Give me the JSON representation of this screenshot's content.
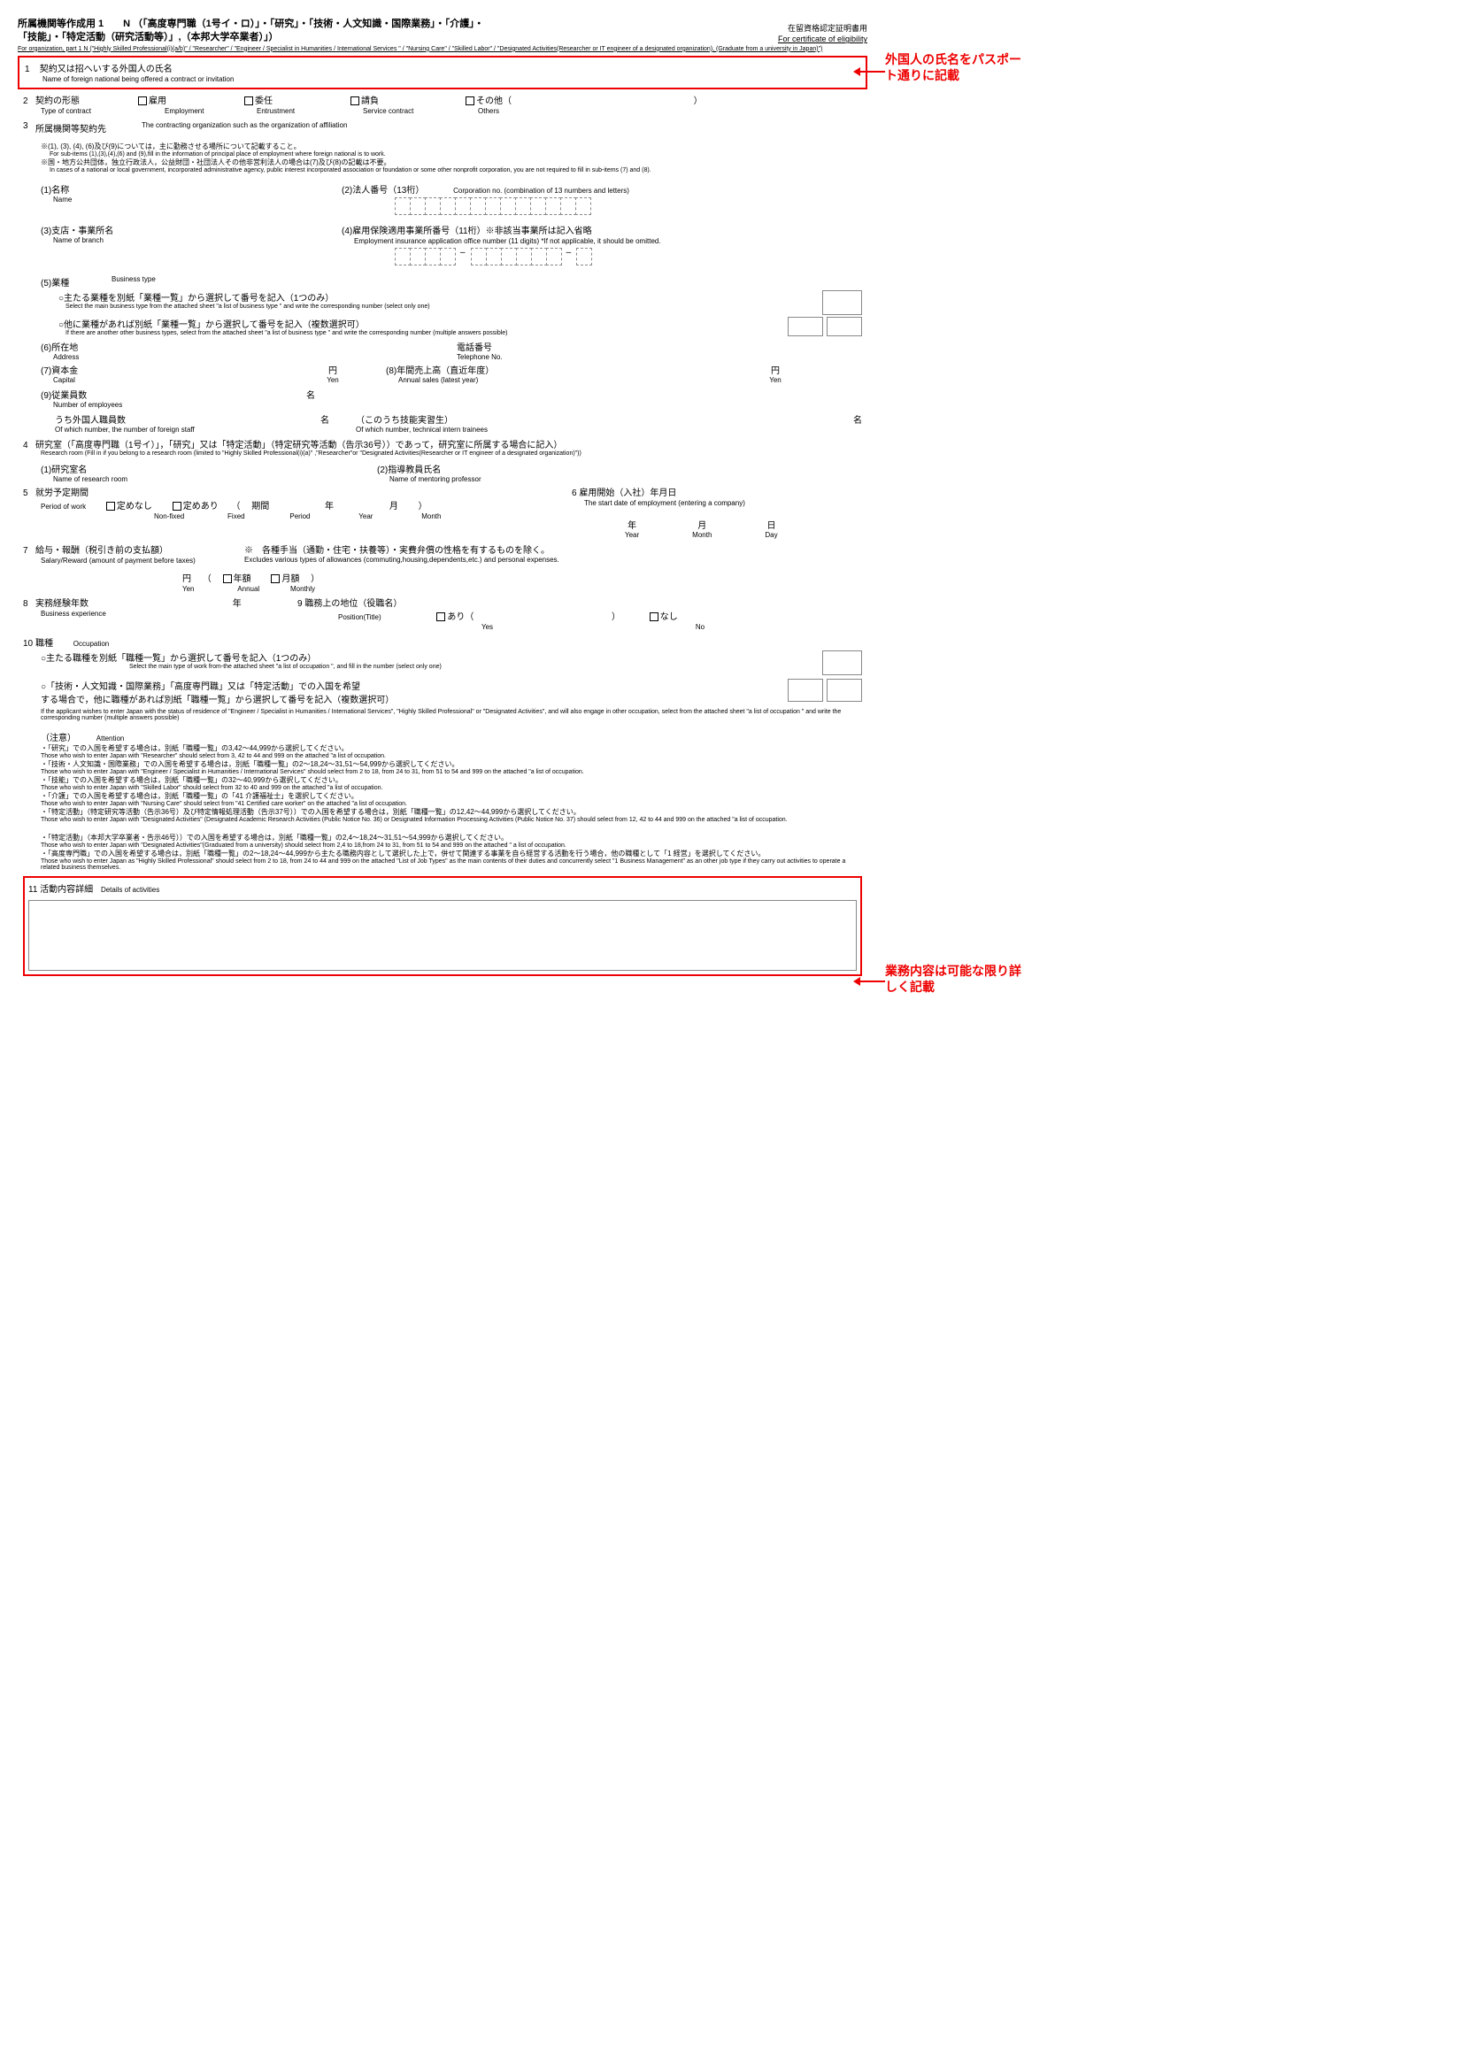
{
  "header": {
    "line1": "所属機関等作成用 1　　N （「高度専門職（1号イ・ロ）」・「研究」・「技術・人文知識・国際業務」・「介護」・",
    "line2": "「技能」・「特定活動（研究活動等）」,（本邦大学卒業者）」）",
    "sub": "For organization, part 1  N  (\"Highly Skilled Professional(i)(a/b)\" / \"Researcher\" / \"Engineer /  Specialist in Humanities  / International Services \" / \"Nursing Care\" /  \"Skilled Labor\" / \"Designated Activities(Researcher or IT engineer of a designated organization),  (Graduate from a university in Japan)\")",
    "cert1": "在留資格認定証明書用",
    "cert2": "For certificate of eligibility"
  },
  "callouts": {
    "name": "外国人の氏名をパスポート通りに記載",
    "activity": "業務内容は可能な限り詳しく記載"
  },
  "s1": {
    "title": "契約又は招へいする外国人の氏名",
    "sub": "Name of foreign national being offered a contract or invitation"
  },
  "s2": {
    "title": "契約の形態",
    "sub": "Type of contract",
    "opt1": "雇用",
    "opt1s": "Employment",
    "opt2": "委任",
    "opt2s": "Entrustment",
    "opt3": "請負",
    "opt3s": "Service contract",
    "opt4": "その他（",
    "opt4s": "Others",
    "paren": "）"
  },
  "s3": {
    "title": "所属機関等契約先",
    "sub": "The contracting organization such as the organization of affiliation",
    "note1": "※(1), (3), (4), (6)及び(9)については，主に勤務させる場所について記載すること。",
    "note1s": "For sub-items (1),(3),(4),(6) and (9),fill in the information of principal place of employment where foreign national is to work.",
    "note2": "※国・地方公共団体，独立行政法人，公益財団・社団法人その他非営利法人の場合は(7)及び(8)の記載は不要。",
    "note2s": "In cases of a national or local government, incorporated administrative agency, public interest incorporated association or foundation or some other nonprofit corporation, you are not required to fill in sub-items (7) and (8).",
    "i1": "(1)名称",
    "i1s": "Name",
    "i2": "(2)法人番号（13桁）",
    "i2s": "Corporation no. (combination of 13 numbers and letters)",
    "i3": "(3)支店・事業所名",
    "i3s": "Name of branch",
    "i4": "(4)雇用保険適用事業所番号（11桁）※非該当事業所は記入省略",
    "i4s": "Employment insurance application office number (11 digits) *If not applicable, it should be omitted.",
    "i5": "(5)業種",
    "i5s": "Business type",
    "i5a": "○主たる業種を別紙「業種一覧」から選択して番号を記入（1つのみ）",
    "i5as": "Select the main business type from the attached sheet \"a list of business type \" and write the corresponding number (select only one)",
    "i5b": "○他に業種があれば別紙「業種一覧」から選択して番号を記入（複数選択可）",
    "i5bs": "If there are another other business types, select from the attached sheet \"a list of business type \" and write the corresponding number  (multiple answers possible)",
    "i6": "(6)所在地",
    "i6s": "Address",
    "tel": "電話番号",
    "tels": "Telephone No.",
    "i7": "(7)資本金",
    "i7s": "Capital",
    "yen": "円",
    "yens": "Yen",
    "i8": "(8)年間売上高（直近年度）",
    "i8s": "Annual sales (latest year)",
    "i9": "(9)従業員数",
    "i9s": "Number of employees",
    "persons": "名",
    "i9a": "うち外国人職員数",
    "i9as": "Of which number, the number of foreign staff",
    "i9b": "（このうち技能実習生）",
    "i9bs": "Of which number, technical intern trainees"
  },
  "s4": {
    "title": "研究室（「高度専門職（1号イ）」，「研究」又は「特定活動」（特定研究等活動（告示36号））であって，研究室に所属する場合に記入）",
    "sub": "Research room (Fill in if you belong to a research room (limited to \"Highly Skilled Professional(i)(a)\" ,\"Researcher\"or  \"Designated Activities(Researcher or IT engineer of a designated organization)\"))",
    "i1": "(1)研究室名",
    "i1s": "Name of research room",
    "i2": "(2)指導教員氏名",
    "i2s": "Name of mentoring professor"
  },
  "s5": {
    "title": "就労予定期間",
    "sub": "Period of work",
    "o1": "定めなし",
    "o1s": "Non-fixed",
    "o2": "定めあり",
    "o2s": "Fixed",
    "period": "期間",
    "periods": "Period",
    "year": "年",
    "years": "Year",
    "month": "月",
    "months": "Month"
  },
  "s6": {
    "title": "雇用開始（入社）年月日",
    "sub": "The start date of employment (entering a company)",
    "year": "年",
    "years": "Year",
    "month": "月",
    "months": "Month",
    "day": "日",
    "days": "Day"
  },
  "s7": {
    "title": "給与・報酬（税引き前の支払額）",
    "sub": "Salary/Reward (amount of payment before taxes)",
    "note": "※　各種手当（通勤・住宅・扶養等）・実費弁償の性格を有するものを除く。",
    "notes": "Excludes various types of allowances (commuting,housing,dependents,etc.) and personal expenses.",
    "yen": "円",
    "yens": "Yen",
    "annual": "年額",
    "annuals": "Annual",
    "monthly": "月額",
    "monthlys": "Monthly"
  },
  "s8": {
    "title": "実務経験年数",
    "sub": "Business experience",
    "year": "年"
  },
  "s9": {
    "title": "職務上の地位（役職名）",
    "sub": "Position(Title)",
    "yes": "あり（",
    "yess": "Yes",
    "paren": "）",
    "no": "なし",
    "nos": "No"
  },
  "s10": {
    "title": "職種",
    "sub": "Occupation",
    "a": "○主たる職種を別紙「職種一覧」から選択して番号を記入（1つのみ）",
    "as": "Select the main type of work from-the attached sheet \"a list of  occupation \", and fill in the number (select only one)",
    "b": "○「技術・人文知識・国際業務」「高度専門職」又は「特定活動」での入国を希望",
    "b2": "する場合で，他に職種があれば別紙「職種一覧」から選択して番号を記入（複数選択可）",
    "bs": "If the applicant wishes to enter Japan with the status of residence of \"Engineer /  Specialist in Humanities  / International Services\", \"Highly Skilled Professional\" or \"Designated Activities\", and will also engage in other  occupation, select from the attached sheet \"a list of  occupation \" and write the corresponding number (multiple answers possible)",
    "attn": "（注意）",
    "attns": "Attention",
    "n1": "・「研究」での入国を希望する場合は，別紙「職種一覧」の3,42～44,999から選択してください。",
    "n1s": "Those who wish to enter Japan with \"Researcher\" should select from 3, 42 to 44 and 999 on the attached \"a list of  occupation.",
    "n2": "・「技術・人文知識・国際業務」での入国を希望する場合は，別紙「職種一覧」の2～18,24～31,51～54,999から選択してください。",
    "n2s": "Those who wish to enter Japan with \"Engineer / Specialist in Humanities / International Services\" should select from 2 to 18, from 24 to 31, from 51 to 54 and 999 on the attached \"a list of  occupation.",
    "n3": "・「技能」での入国を希望する場合は，別紙「職種一覧」の32～40,999から選択してください。",
    "n3s": "Those who wish to enter Japan with \"Skilled Labor\" should select from 32 to 40 and 999 on the attached \"a list of  occupation.",
    "n4": "・「介護」での入国を希望する場合は，別紙「職種一覧」の「41 介護福祉士」を選択してください。",
    "n4s": "Those who wish to enter Japan with \"Nursing Care\" should select from \"41 Certified care worker\" on the attached \"a list of  occupation.",
    "n5": "・「特定活動」（特定研究等活動（告示36号）及び特定情報処理活動（告示37号））での入国を希望する場合は，別紙「職種一覧」の12,42～44,999から選択してください。",
    "n5s": "Those who wish to enter Japan with \"Designated Activities\" (Designated Academic Research Activities (Public Notice No. 36) or Designated Information Processing Activities (Public Notice No. 37) should select from 12, 42 to 44 and 999 on the attached \"a list of occupation.",
    "n6": "・「特定活動」（本邦大学卒業者・告示46号））での入国を希望する場合は，別紙「職種一覧」の2,4～18,24～31,51～54,999から選択してください。",
    "n6s": "Those who wish to enter Japan with \"Designated Activities\"(Graduated from a university)  should select from 2,4 to 18,from 24 to 31, from 51 to 54 and 999 on the attached \" a list of occupation.",
    "n7": "・「高度専門職」での入国を希望する場合は，別紙「職種一覧」の2～18,24～44,999から主たる職務内容として選択した上で，併せて関連する事業を自ら経営する活動を行う場合，他の職種として「1 経営」を選択してください。",
    "n7s": "Those who wish to enter Japan as \"Highly Skilled Professional\" should select from 2 to 18, from 24 to 44 and 999 on the attached \"List of Job Types\" as the main contents of their duties and concurrently select \"1 Business Management\" as an other job type if they carry out activities to operate a related business themselves."
  },
  "s11": {
    "title": "活動内容詳細",
    "sub": "Details of activities"
  }
}
